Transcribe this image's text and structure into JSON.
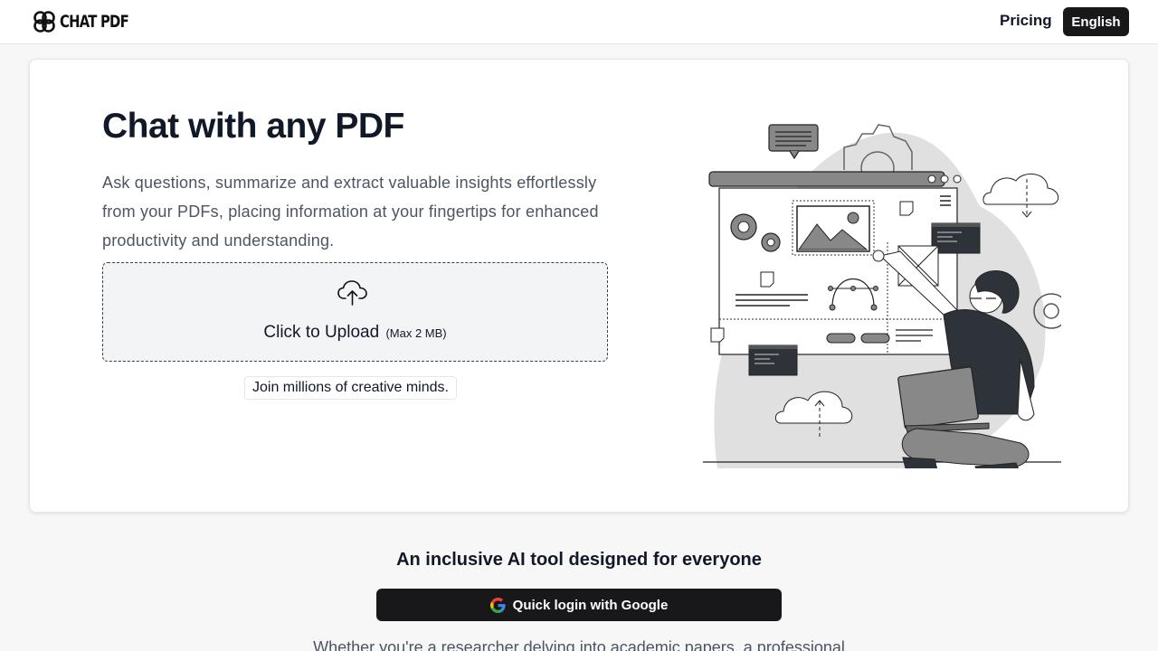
{
  "header": {
    "logo_text": "CHAT PDF",
    "nav": {
      "pricing": "Pricing",
      "language": "English"
    }
  },
  "hero": {
    "title": "Chat with any PDF",
    "description": "Ask questions, summarize and extract valuable insights effortlessly from your PDFs, placing information at your fingertips for enhanced productivity and understanding.",
    "upload": {
      "label": "Click to Upload",
      "max_size": "(Max 2 MB)",
      "icon": "cloud-upload-icon"
    },
    "social_proof": "Join millions of creative minds.",
    "illustration": "person-with-laptop-illustration"
  },
  "section": {
    "tagline": "An inclusive AI tool designed for everyone",
    "google_login": {
      "label": "Quick login with Google",
      "icon": "google-icon"
    },
    "body_text": "Whether you're a researcher delving into academic papers, a professional"
  },
  "colors": {
    "primary_dark": "#18181b",
    "text": "#111827",
    "muted_text": "#4b5563",
    "upload_bg": "#f3f4f6",
    "page_bg": "#f7f7f8"
  }
}
